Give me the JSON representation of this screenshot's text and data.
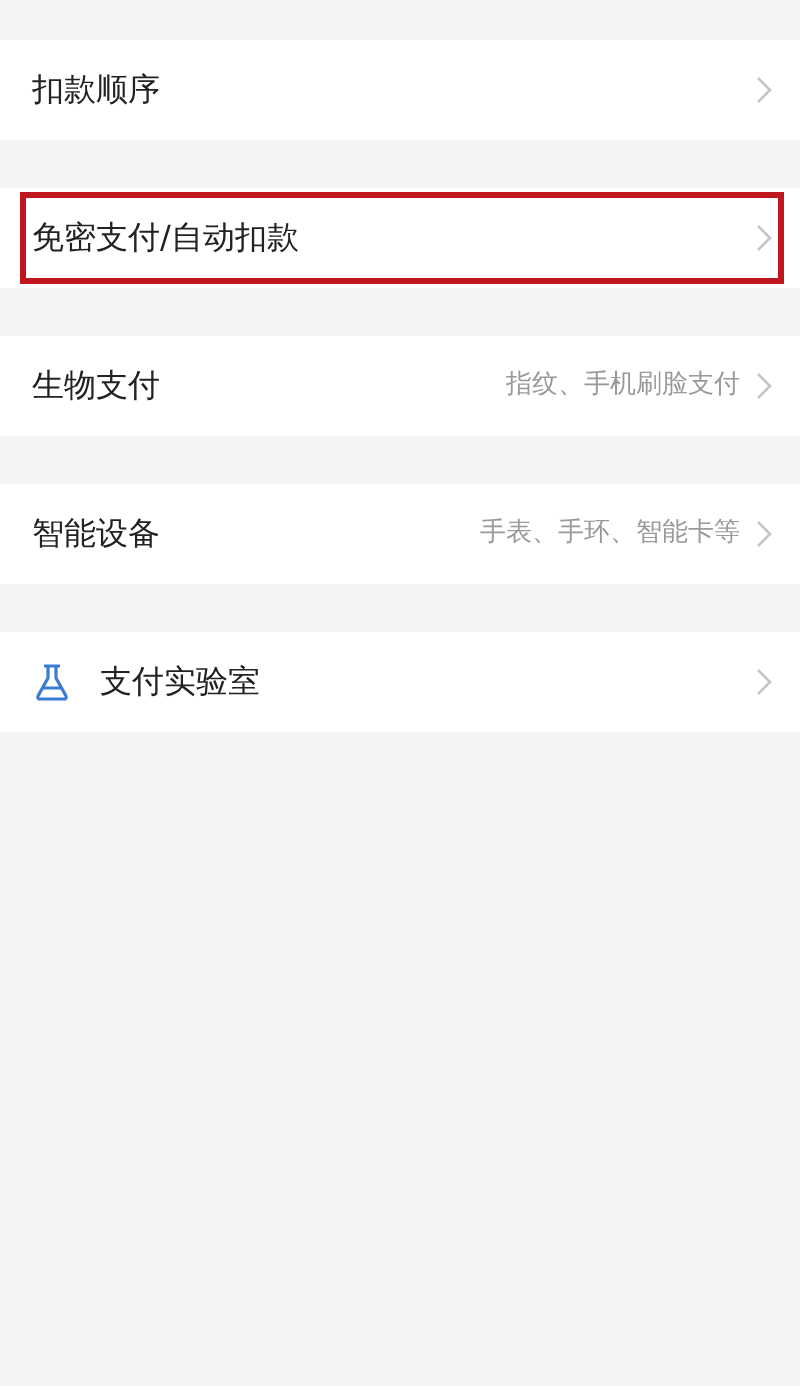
{
  "groups": [
    {
      "items": [
        {
          "label": "扣款顺序",
          "highlighted": false
        }
      ]
    },
    {
      "items": [
        {
          "label": "免密支付/自动扣款",
          "highlighted": true
        }
      ]
    },
    {
      "items": [
        {
          "label": "生物支付",
          "detail": "指纹、手机刷脸支付",
          "highlighted": false
        }
      ]
    },
    {
      "items": [
        {
          "label": "智能设备",
          "detail": "手表、手环、智能卡等",
          "highlighted": false
        }
      ]
    },
    {
      "items": [
        {
          "label": "支付实验室",
          "kind": "lab",
          "highlighted": false
        }
      ]
    }
  ]
}
